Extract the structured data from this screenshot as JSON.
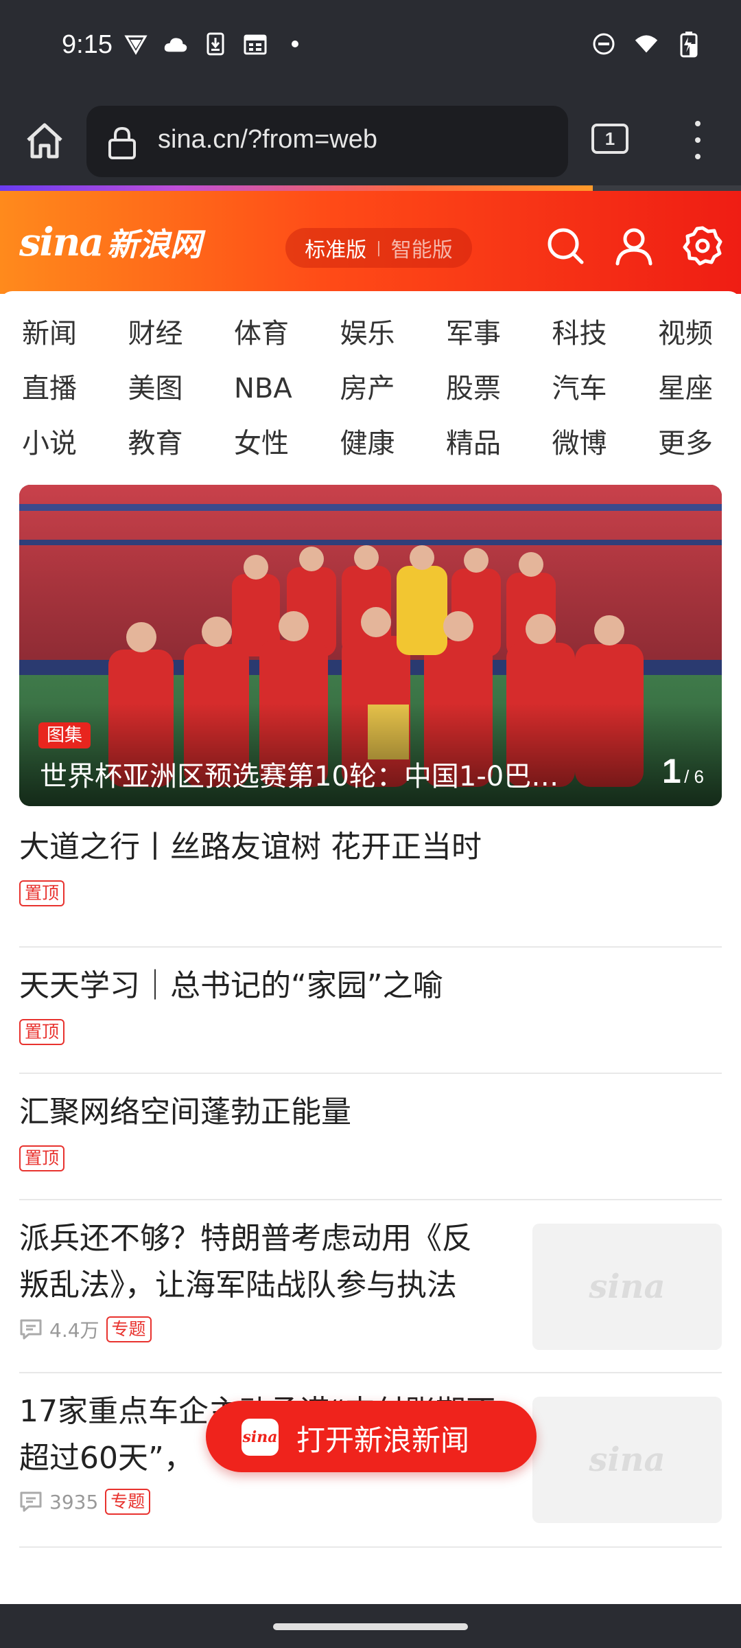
{
  "status_bar": {
    "time": "9:15",
    "left_icons": [
      "vpn-icon",
      "cloud-icon",
      "download-icon",
      "calendar-icon",
      "dot-icon"
    ],
    "right_icons": [
      "do-not-disturb-icon",
      "wifi-icon",
      "battery-charging-icon"
    ]
  },
  "browser": {
    "url": "sina.cn/?from=web",
    "tab_count": "1",
    "progress_fraction": 0.8
  },
  "header": {
    "logo_word": "sina",
    "logo_cn": "新浪网",
    "version_active": "标准版",
    "version_separator": "|",
    "version_inactive": "智能版"
  },
  "nav": {
    "items": [
      "新闻",
      "财经",
      "体育",
      "娱乐",
      "军事",
      "科技",
      "视频",
      "直播",
      "美图",
      "NBA",
      "房产",
      "股票",
      "汽车",
      "星座",
      "小说",
      "教育",
      "女性",
      "健康",
      "精品",
      "微博",
      "更多"
    ]
  },
  "hero": {
    "badge": "图集",
    "title": "世界杯亚洲区预选赛第10轮：中国1-0巴…",
    "page_current": "1",
    "page_total": "/ 6"
  },
  "news": [
    {
      "title": "大道之行丨丝路友谊树 花开正当时",
      "tag": "置顶"
    },
    {
      "title": "天天学习｜总书记的“家园”之喻",
      "tag": "置顶"
    },
    {
      "title": "汇聚网络空间蓬勃正能量",
      "tag": "置顶"
    },
    {
      "title": "派兵还不够？特朗普考虑动用《反叛乱法》，让海军陆战队参与执法",
      "comments": "4.4万",
      "tag": "专题",
      "thumb": "sina"
    },
    {
      "title": "17家重点车企主动承诺“支付账期不超过60天”，",
      "comments": "3935",
      "tag": "专题",
      "thumb": "sina"
    }
  ],
  "open_app": {
    "icon_text": "sina",
    "label": "打开新浪新闻"
  },
  "colors": {
    "accent": "#ef231c",
    "header_start": "#ff8a1c",
    "header_end": "#ef1d14",
    "chrome": "#2a2c32"
  }
}
